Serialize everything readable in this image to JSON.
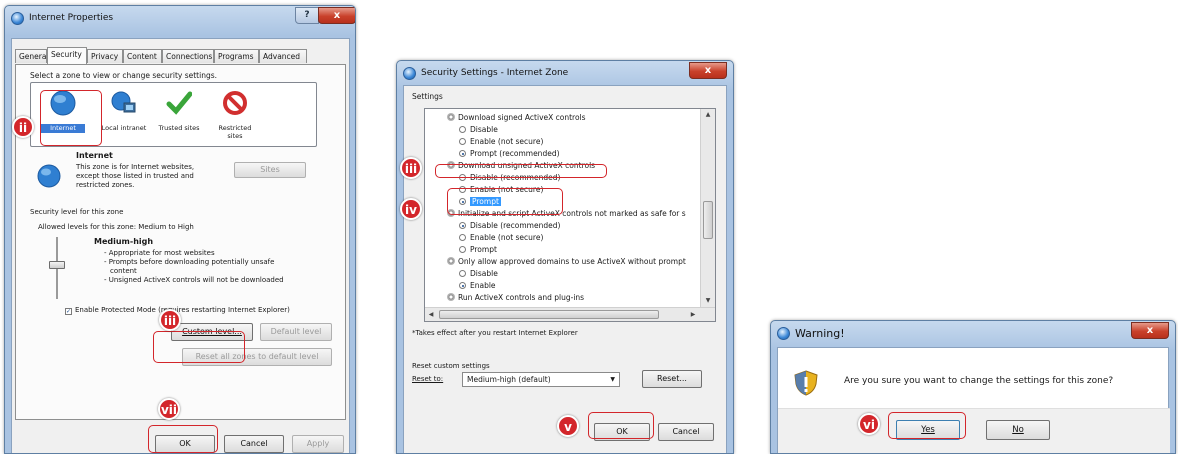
{
  "dialog1": {
    "title": "Internet Properties",
    "help_label": "?",
    "close_label": "x",
    "tabs": [
      "General",
      "Security",
      "Privacy",
      "Content",
      "Connections",
      "Programs",
      "Advanced"
    ],
    "select_zone_text": "Select a zone to view or change security settings.",
    "zones": [
      {
        "label": "Internet",
        "icon": "globe-icon"
      },
      {
        "label": "Local intranet",
        "icon": "network-icon"
      },
      {
        "label": "Trusted sites",
        "icon": "checkmark-icon"
      },
      {
        "label": "Restricted sites",
        "icon": "blocked-icon"
      }
    ],
    "zone_name": "Internet",
    "zone_desc": [
      "This zone is for Internet websites,",
      "except those listed in trusted and",
      "restricted zones."
    ],
    "sites_label": "Sites",
    "security_level_label": "Security level for this zone",
    "allowed_levels": "Allowed levels for this zone: Medium to High",
    "level_name": "Medium-high",
    "level_points": [
      "- Appropriate for most websites",
      "- Prompts before downloading potentially unsafe",
      "  content",
      "- Unsigned ActiveX controls will not be downloaded"
    ],
    "protected_mode": "Enable Protected Mode (requires restarting Internet Explorer)",
    "custom_level": "Custom level...",
    "default_level": "Default level",
    "reset_all": "Reset all zones to default level",
    "ok": "OK",
    "cancel": "Cancel",
    "apply": "Apply"
  },
  "dialog2": {
    "title": "Security Settings - Internet Zone",
    "close_label": "x",
    "settings_label": "Settings",
    "items": [
      {
        "kind": "group",
        "label": "Download signed ActiveX controls"
      },
      {
        "kind": "radio",
        "label": "Disable",
        "on": false
      },
      {
        "kind": "radio",
        "label": "Enable (not secure)",
        "on": false
      },
      {
        "kind": "radio",
        "label": "Prompt (recommended)",
        "on": true
      },
      {
        "kind": "group",
        "label": "Download unsigned ActiveX controls"
      },
      {
        "kind": "radio",
        "label": "Disable (recommended)",
        "on": false
      },
      {
        "kind": "radio",
        "label": "Enable (not secure)",
        "on": false
      },
      {
        "kind": "radio",
        "label": "Prompt",
        "on": true
      },
      {
        "kind": "group",
        "label": "Initialize and script ActiveX controls not marked as safe for s"
      },
      {
        "kind": "radio",
        "label": "Disable (recommended)",
        "on": true
      },
      {
        "kind": "radio",
        "label": "Enable (not secure)",
        "on": false
      },
      {
        "kind": "radio",
        "label": "Prompt",
        "on": false
      },
      {
        "kind": "group",
        "label": "Only allow approved domains to use ActiveX without prompt"
      },
      {
        "kind": "radio",
        "label": "Disable",
        "on": false
      },
      {
        "kind": "radio",
        "label": "Enable",
        "on": true
      },
      {
        "kind": "group",
        "label": "Run ActiveX controls and plug-ins"
      }
    ],
    "note": "*Takes effect after you restart Internet Explorer",
    "reset_custom": "Reset custom settings",
    "reset_to": "Reset to:",
    "reset_value": "Medium-high (default)",
    "reset_button": "Reset...",
    "ok": "OK",
    "cancel": "Cancel"
  },
  "dialog3": {
    "title": "Warning!",
    "close_label": "x",
    "message": "Are you sure you want to change the settings for this zone?",
    "yes": "Yes",
    "no": "No"
  },
  "badges": {
    "ii": "ii",
    "iii_a": "iii",
    "vii": "vii",
    "iii_b": "iii",
    "iv": "iv",
    "v": "v",
    "vi": "vi"
  },
  "colors": {
    "badge": "#d3262b",
    "highlight": "#d3262b"
  }
}
